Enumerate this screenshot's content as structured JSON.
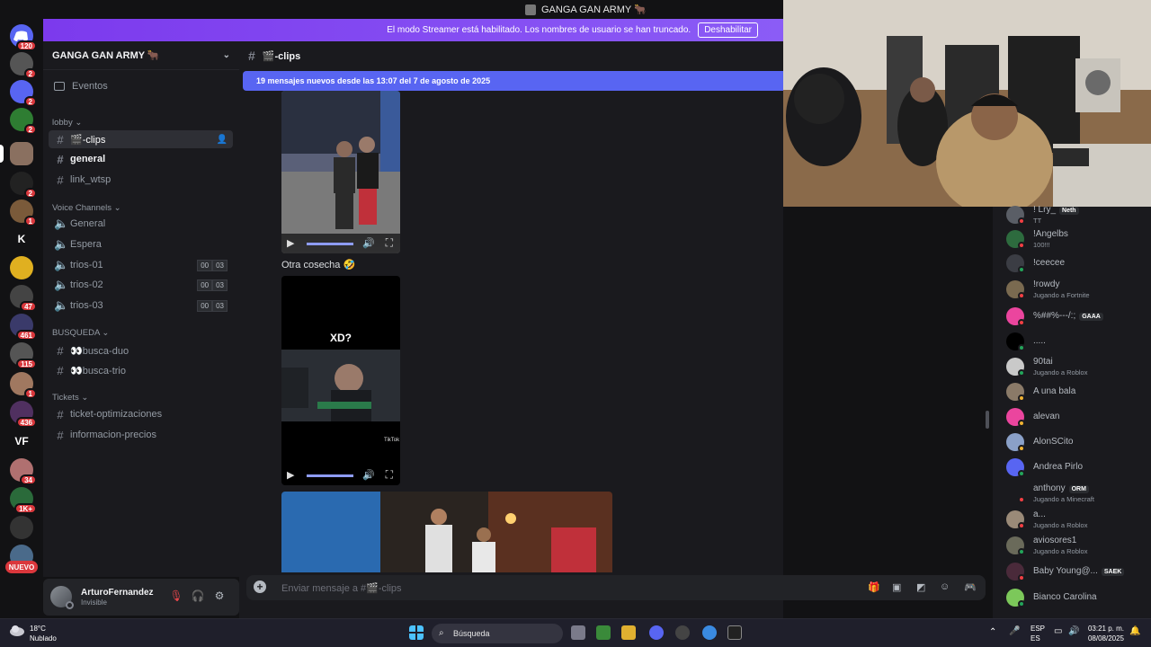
{
  "window": {
    "title": "GANGA GAN ARMY 🐂"
  },
  "server_rail": {
    "badges": [
      "120",
      "2",
      "2",
      "2",
      "2",
      "1",
      "47",
      "461",
      "115",
      "1",
      "436",
      "34",
      "1K+"
    ],
    "letters": [
      "K",
      "VF"
    ],
    "new_label": "NUEVO"
  },
  "streamer_banner": {
    "text": "El modo Streamer está habilitado. Los nombres de usuario se han truncado.",
    "button": "Deshabilitar"
  },
  "sidebar": {
    "server_name": "GANGA GAN ARMY 🐂",
    "events": "Eventos",
    "categories": {
      "lobby": "lobby",
      "voice": "Voice Channels",
      "busqueda": "BUSQUEDA",
      "tickets": "Tickets"
    },
    "lobby_channels": [
      "🎬-clips",
      "general",
      "link_wtsp"
    ],
    "voice_channels": [
      {
        "name": "General"
      },
      {
        "name": "Espera"
      },
      {
        "name": "trios-01",
        "a": "00",
        "b": "03"
      },
      {
        "name": "trios-02",
        "a": "00",
        "b": "03"
      },
      {
        "name": "trios-03",
        "a": "00",
        "b": "03"
      }
    ],
    "busqueda_channels": [
      "👀busca-duo",
      "👀busca-trio"
    ],
    "ticket_channels": [
      "ticket-optimizaciones",
      "informacion-precios"
    ]
  },
  "user": {
    "name": "ArturoFernandez",
    "status": "Invisible"
  },
  "chat": {
    "channel": "🎬-clips",
    "new_messages": "19 mensajes nuevos desde las 13:07 del 7 de agosto de 2025",
    "message_text": "Otra cosecha 🤣",
    "video_overlay": "XD?",
    "tiktok_label": "TikTok",
    "composer_placeholder": "Enviar mensaje a #🎬-clips"
  },
  "members": [
    {
      "name": "! Lry_",
      "activity": "TT",
      "tag": "Neth",
      "color": "#5a5e66",
      "status": "#f23f43"
    },
    {
      "name": "!Angelbs",
      "activity": "100!!!",
      "color": "#2d6b3e",
      "status": "#f23f43"
    },
    {
      "name": "!ceecee",
      "activity": "",
      "color": "#3b3d44",
      "status": "#23a55a"
    },
    {
      "name": "!rowdy",
      "activity": "Jugando a Fortnite",
      "color": "#7a6a50",
      "status": "#f23f43"
    },
    {
      "name": "%##%---/:;",
      "activity": "",
      "tag": "GAAA",
      "color": "#eb459e",
      "status": "#f23f43"
    },
    {
      "name": ".....",
      "activity": "",
      "color": "#000000",
      "status": "#23a55a"
    },
    {
      "name": "90tai",
      "activity": "Jugando a Roblox",
      "color": "#c9c9c9",
      "status": "#23a55a"
    },
    {
      "name": "A una bala",
      "activity": "",
      "color": "#8a7a68",
      "status": "#f0b232"
    },
    {
      "name": "alevan",
      "activity": "",
      "color": "#eb459e",
      "status": "#f0b232"
    },
    {
      "name": "AlonSCito",
      "activity": "",
      "color": "#8aa0c8",
      "status": "#f0b232"
    },
    {
      "name": "Andrea Pirlo",
      "activity": "",
      "color": "#5865f2",
      "status": "#23a55a"
    },
    {
      "name": "anthony",
      "activity": "Jugando a Minecraft",
      "tag": "ORM",
      "color": "#1a1a1e",
      "status": "#f23f43"
    },
    {
      "name": "a...",
      "activity": "Jugando a Roblox",
      "color": "#9a8a78",
      "status": "#f23f43"
    },
    {
      "name": "aviosores1",
      "activity": "Jugando a Roblox",
      "color": "#6a6a5a",
      "status": "#23a55a"
    },
    {
      "name": "Baby Young@...",
      "activity": "",
      "tag": "SAEK",
      "color": "#4a2a3a",
      "status": "#f23f43"
    },
    {
      "name": "Bianco Carolina",
      "activity": "",
      "color": "#7cc85a",
      "status": "#23a55a"
    }
  ],
  "taskbar": {
    "temp": "18°C",
    "condition": "Nublado",
    "search_placeholder": "Búsqueda",
    "lang1": "ESP",
    "lang2": "ES",
    "time": "03:21 p. m.",
    "date": "08/08/2025"
  }
}
